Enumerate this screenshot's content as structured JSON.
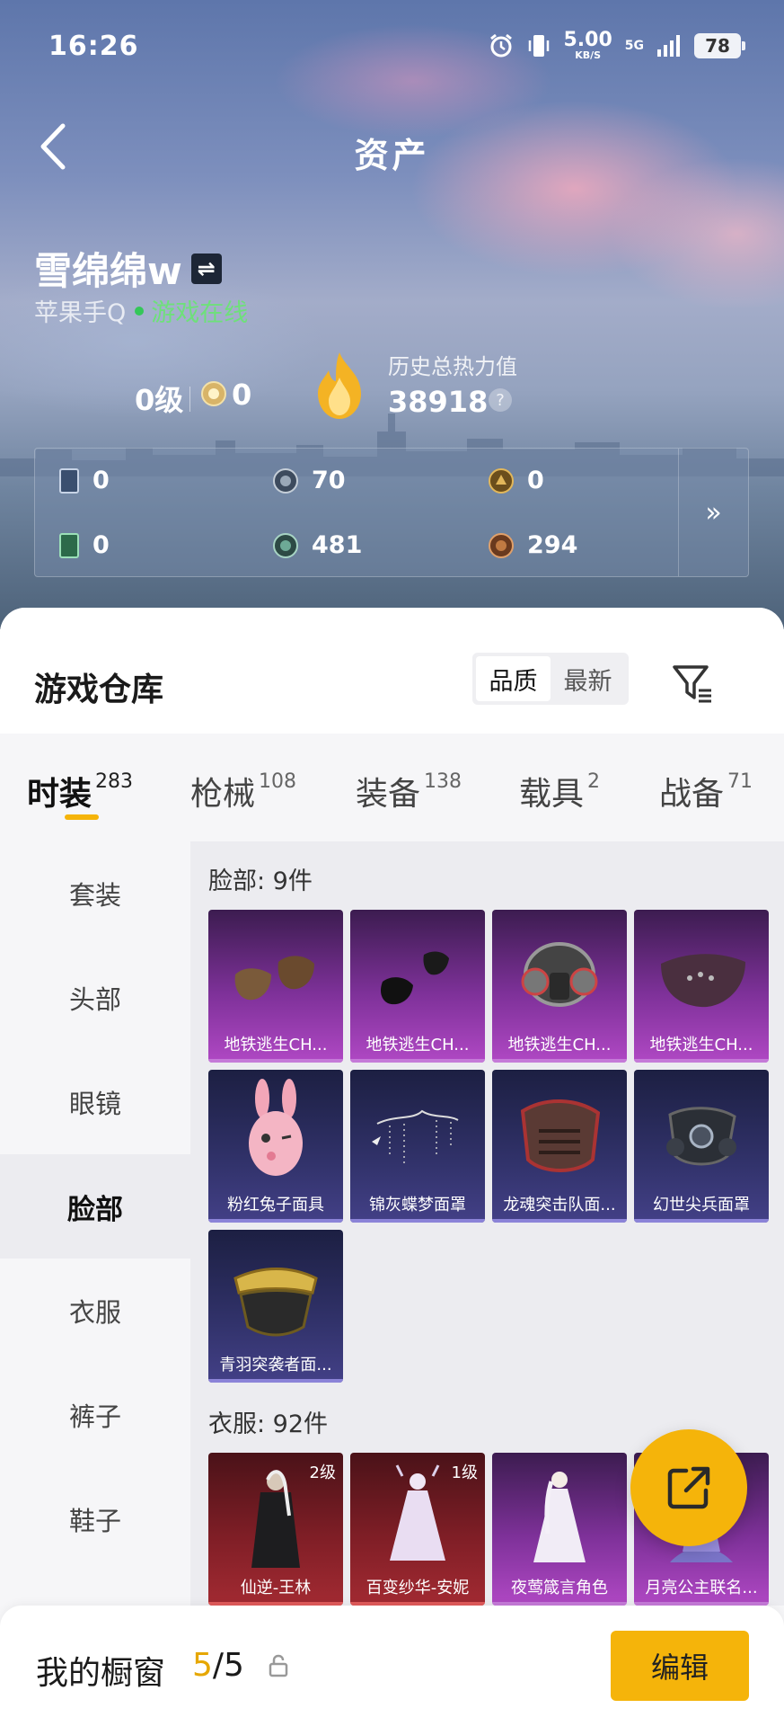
{
  "status_bar": {
    "time": "16:26",
    "speed_value": "5.00",
    "speed_unit": "KB/S",
    "network": "5G",
    "battery": "78"
  },
  "header": {
    "title": "资产",
    "back_icon": "chevron-left-icon"
  },
  "profile": {
    "name": "雪绵绵w",
    "switch_glyph": "⇌",
    "platform": "苹果手Q",
    "online_status": "游戏在线",
    "level": "0级",
    "rank_value": "0",
    "heat_label": "历史总热力值",
    "heat_value": "38918",
    "help_glyph": "?"
  },
  "currencies": [
    {
      "icon": "card-icon",
      "value": "0"
    },
    {
      "icon": "coin-icon",
      "value": "70"
    },
    {
      "icon": "gold-badge-icon",
      "value": "0"
    },
    {
      "icon": "green-card-icon",
      "value": "0"
    },
    {
      "icon": "green-coin-icon",
      "value": "481"
    },
    {
      "icon": "bronze-coin-icon",
      "value": "294"
    }
  ],
  "currency_more": "»",
  "warehouse": {
    "title": "游戏仓库",
    "sort_options": [
      "品质",
      "最新"
    ],
    "active_sort": "品质"
  },
  "category_tabs": [
    {
      "label": "时装",
      "count": "283",
      "active": true
    },
    {
      "label": "枪械",
      "count": "108"
    },
    {
      "label": "装备",
      "count": "138"
    },
    {
      "label": "载具",
      "count": "2"
    },
    {
      "label": "战备",
      "count": "71"
    }
  ],
  "side_nav": [
    "套装",
    "头部",
    "眼镜",
    "脸部",
    "衣服",
    "裤子",
    "鞋子"
  ],
  "side_nav_active": "脸部",
  "sections": [
    {
      "label": "脸部: 9件",
      "items": [
        {
          "name": "地铁逃生CH...",
          "rarity": "purple",
          "art": "mask-brown-icon"
        },
        {
          "name": "地铁逃生CH...",
          "rarity": "purple",
          "art": "mask-black-icon"
        },
        {
          "name": "地铁逃生CH...",
          "rarity": "purple",
          "art": "gas-mask-icon"
        },
        {
          "name": "地铁逃生CH...",
          "rarity": "purple",
          "art": "mask-studded-icon"
        },
        {
          "name": "粉红兔子面具",
          "rarity": "indigo",
          "art": "bunny-mask-icon"
        },
        {
          "name": "锦灰蝶梦面罩",
          "rarity": "indigo",
          "art": "butterfly-veil-icon"
        },
        {
          "name": "龙魂突击队面...",
          "rarity": "indigo",
          "art": "dragon-mask-icon"
        },
        {
          "name": "幻世尖兵面罩",
          "rarity": "indigo",
          "art": "respirator-icon"
        },
        {
          "name": "青羽突袭者面...",
          "rarity": "indigo",
          "art": "goggle-mask-icon"
        }
      ]
    },
    {
      "label": "衣服: 92件",
      "items": [
        {
          "name": "仙逆-王林",
          "rarity": "red",
          "level": "2级",
          "art": "coat-figure-icon"
        },
        {
          "name": "百变纱华-安妮",
          "rarity": "red",
          "level": "1级",
          "art": "dress-figure-icon"
        },
        {
          "name": "夜莺箴言角色",
          "rarity": "purple",
          "art": "gown-figure-icon"
        },
        {
          "name": "月亮公主联名...",
          "rarity": "purple",
          "art": "princess-figure-icon"
        }
      ]
    }
  ],
  "showcase": {
    "label": "我的橱窗",
    "current": "5",
    "total": "/5",
    "edit_label": "编辑"
  },
  "colors": {
    "accent": "#f5b40a",
    "online": "#34c759"
  }
}
